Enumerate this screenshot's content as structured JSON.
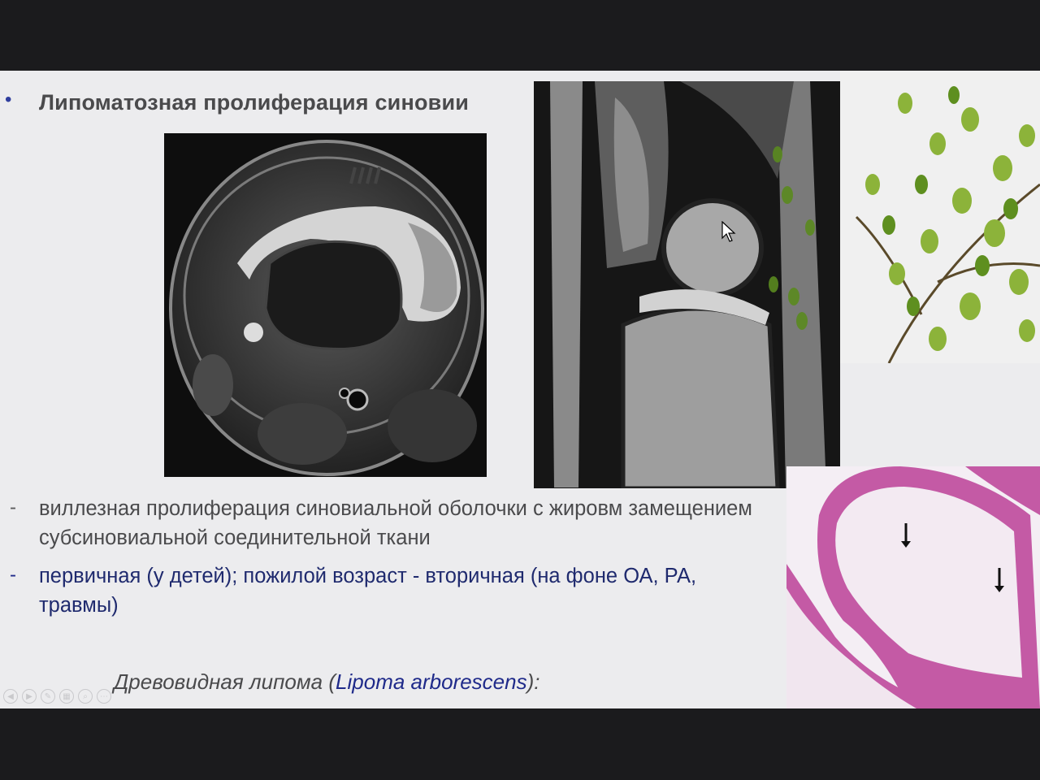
{
  "slide": {
    "heading": "Липоматозная пролиферация синовии",
    "points": [
      {
        "dash": "-",
        "text": "виллезная пролиферация синовиальной оболочки с жировм замещением субсиновиальной  соединительной ткани"
      },
      {
        "dash": "-",
        "text": "первичная (у детей); пожилой возраст - вторичная (на фоне ОА, РА, травмы)"
      }
    ],
    "caption": {
      "prefix": "Древовидная липома (",
      "latin": "Lipoma arborescens",
      "suffix": "):"
    }
  },
  "images": {
    "axial": "axial-mri-image",
    "sagittal": "sagittal-mri-image",
    "tree": "tree-leaves-image",
    "histology": "histology-image"
  },
  "controls": [
    "previous-icon",
    "next-icon",
    "pen-icon",
    "slides-icon",
    "zoom-icon",
    "more-icon"
  ],
  "colors": {
    "slide_background": "#ececee",
    "heading": "#4a4a4c",
    "accent_blue": "#1f2a8a",
    "letterbox": "#1b1b1d"
  }
}
